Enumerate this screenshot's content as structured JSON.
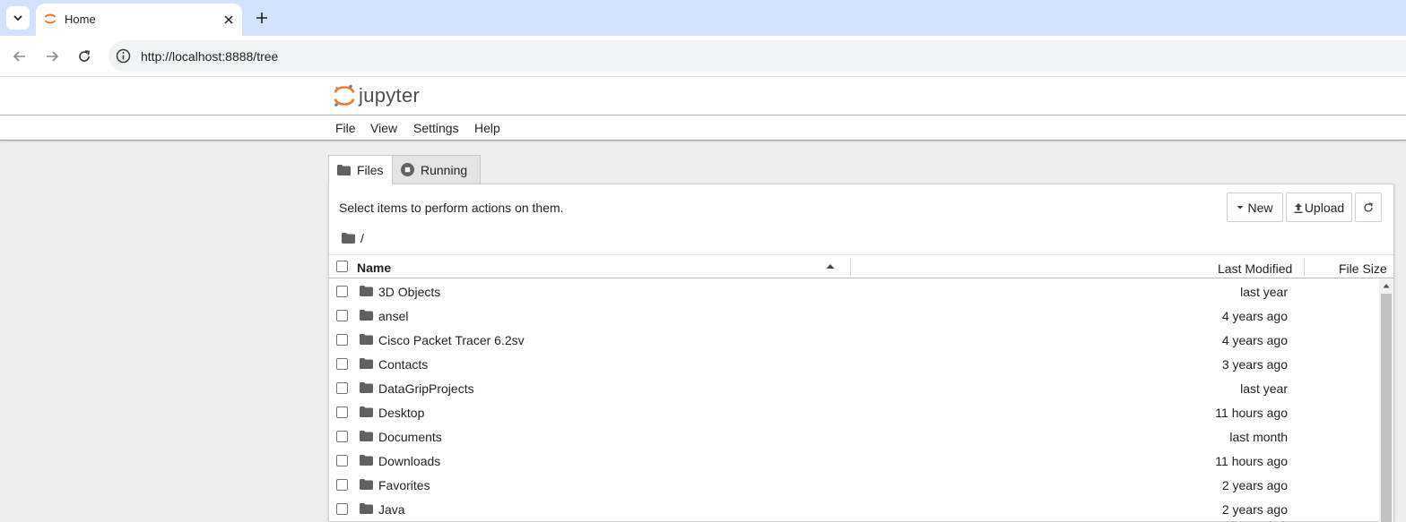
{
  "browser": {
    "tab_title": "Home",
    "url": "http://localhost:8888/tree"
  },
  "jupyter": {
    "logo_text": "jupyter",
    "menu": [
      "File",
      "View",
      "Settings",
      "Help"
    ],
    "tabs": [
      {
        "label": "Files",
        "active": true
      },
      {
        "label": "Running",
        "active": false
      }
    ],
    "hint": "Select items to perform actions on them.",
    "buttons": {
      "new": "New",
      "upload": "Upload"
    },
    "breadcrumb": "/",
    "columns": {
      "name": "Name",
      "last_modified": "Last Modified",
      "file_size": "File Size"
    },
    "files": [
      {
        "name": "3D Objects",
        "modified": "last year"
      },
      {
        "name": "ansel",
        "modified": "4 years ago"
      },
      {
        "name": "Cisco Packet Tracer 6.2sv",
        "modified": "4 years ago"
      },
      {
        "name": "Contacts",
        "modified": "3 years ago"
      },
      {
        "name": "DataGripProjects",
        "modified": "last year"
      },
      {
        "name": "Desktop",
        "modified": "11 hours ago"
      },
      {
        "name": "Documents",
        "modified": "last month"
      },
      {
        "name": "Downloads",
        "modified": "11 hours ago"
      },
      {
        "name": "Favorites",
        "modified": "2 years ago"
      },
      {
        "name": "Java",
        "modified": "2 years ago"
      }
    ]
  },
  "colors": {
    "accent": "#f37726",
    "tabstrip": "#d3e3fd"
  }
}
